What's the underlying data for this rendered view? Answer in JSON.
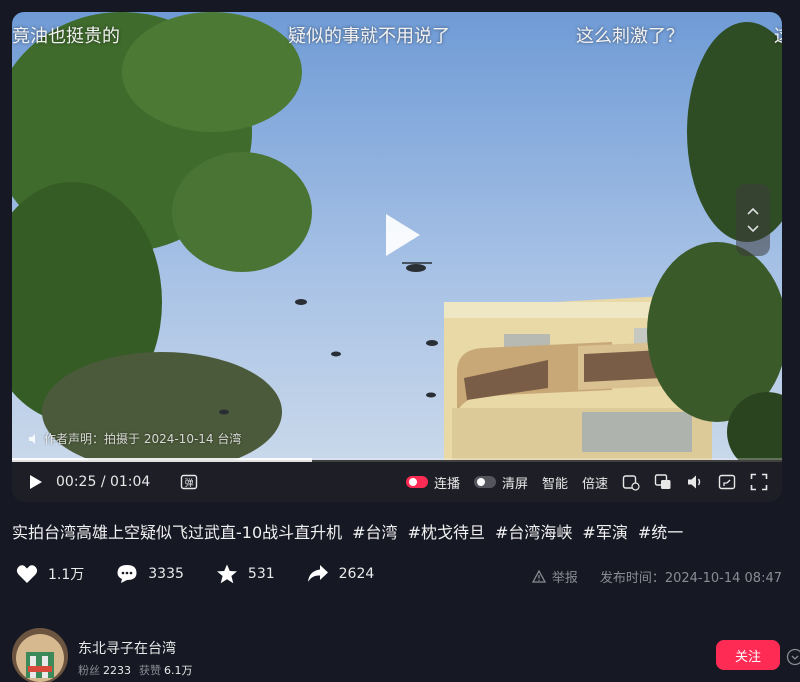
{
  "video": {
    "danmaku": [
      "竟油也挺贵的",
      "疑似的事就不用说了",
      "这么刺激了？",
      "这"
    ],
    "watermark": "作者声明：拍摄于 2024-10-14 台湾",
    "progress_fraction": 0.39,
    "time_current": "00:25",
    "time_separator": "/",
    "time_total": "01:04",
    "controls": {
      "danmaku_toggle_label": "连播",
      "clear_screen_label": "清屏",
      "smart_label": "智能",
      "speed_label": "倍速"
    },
    "danmaku_toggle_on": true,
    "clear_screen_on": false
  },
  "title": {
    "text": "实拍台湾高雄上空疑似飞过武直-10战斗直升机",
    "tags": [
      "#台湾",
      "#枕戈待旦",
      "#台湾海峡",
      "#军演",
      "#统一"
    ]
  },
  "stats": {
    "likes": "1.1万",
    "comments": "3335",
    "favorites": "531",
    "shares": "2624"
  },
  "meta": {
    "report_label": "举报",
    "publish_label": "发布时间：",
    "publish_time": "2024-10-14 08:47"
  },
  "author": {
    "name": "东北寻子在台湾",
    "fans_label": "粉丝",
    "fans": "2233",
    "likes_label": "获赞",
    "likes": "6.1万",
    "follow_label": "关注"
  },
  "colors": {
    "accent": "#fe2c55",
    "background": "#161823",
    "muted_text": "#8b8c93"
  },
  "icons": [
    "play-icon",
    "danmaku-icon",
    "heart-icon",
    "comment-icon",
    "star-icon",
    "share-icon",
    "warning-icon",
    "volume-icon",
    "fullscreen-icon"
  ]
}
